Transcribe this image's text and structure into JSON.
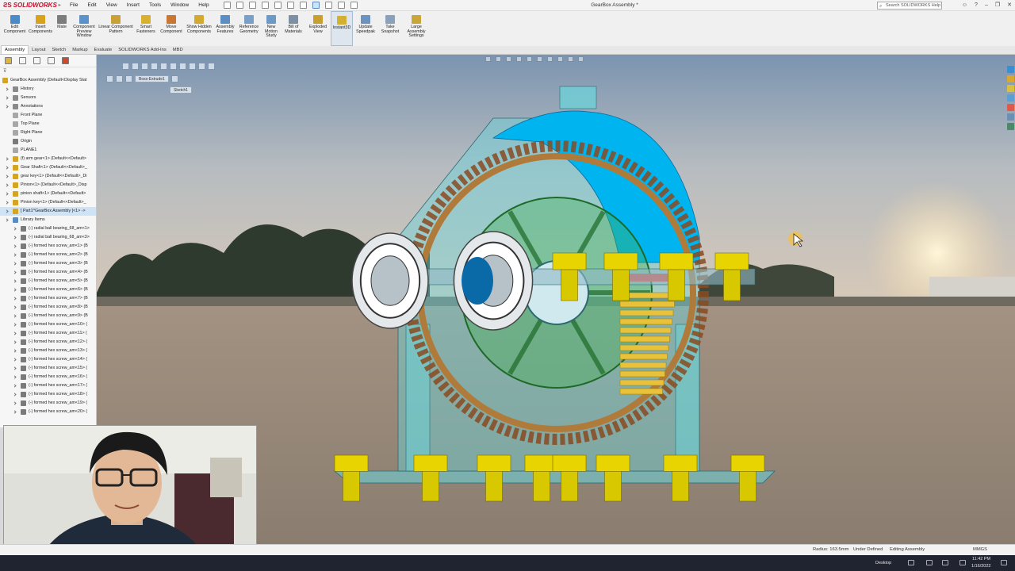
{
  "app": {
    "logo": "SOLIDWORKS",
    "window_title": "GearBox Assembly *",
    "search_placeholder": "Search SOLIDWORKS Help"
  },
  "menu": [
    "File",
    "Edit",
    "View",
    "Insert",
    "Tools",
    "Window",
    "Help"
  ],
  "commands": [
    {
      "label": "Edit Component",
      "icon": "edit-component-icon",
      "color": "#4a8ac8"
    },
    {
      "label": "Insert Components",
      "icon": "insert-components-icon",
      "color": "#d9a21b"
    },
    {
      "label": "Mate",
      "icon": "mate-icon",
      "color": "#7c7c7c"
    },
    {
      "label": "Component Preview Window",
      "icon": "component-preview-icon",
      "color": "#5a92c9"
    },
    {
      "label": "Linear Component Pattern",
      "icon": "linear-pattern-icon",
      "color": "#c9a137"
    },
    {
      "label": "Smart Fasteners",
      "icon": "smart-fasteners-icon",
      "color": "#d8b12e"
    },
    {
      "label": "Move Component",
      "icon": "move-component-icon",
      "color": "#c87832"
    },
    {
      "label": "Show Hidden Components",
      "icon": "show-hidden-icon",
      "color": "#d4a930"
    },
    {
      "label": "Assembly Features",
      "icon": "assembly-features-icon",
      "color": "#5b8fc4"
    },
    {
      "label": "Reference Geometry",
      "icon": "reference-geometry-icon",
      "color": "#7ba0c8"
    },
    {
      "label": "New Motion Study",
      "icon": "motion-study-icon",
      "color": "#6c9ac6"
    },
    {
      "label": "Bill of Materials",
      "icon": "bom-icon",
      "color": "#7d8fa3"
    },
    {
      "label": "Exploded View",
      "icon": "exploded-view-icon",
      "color": "#c9a030"
    },
    {
      "label": "Instant3D",
      "icon": "instant3d-icon",
      "color": "#d1b032"
    },
    {
      "label": "Update Speedpak",
      "icon": "speedpak-icon",
      "color": "#6b93c0"
    },
    {
      "label": "Take Snapshot",
      "icon": "snapshot-icon",
      "color": "#8aa1bb"
    },
    {
      "label": "Large Assembly Settings",
      "icon": "large-assembly-icon",
      "color": "#c9a53a"
    }
  ],
  "tabs": [
    "Assembly",
    "Layout",
    "Sketch",
    "Markup",
    "Evaluate",
    "SOLIDWORKS Add-Ins",
    "MBD"
  ],
  "tree": {
    "root": "GearBox Assembly  (Default<Display Stat",
    "items": [
      {
        "label": "History",
        "icon": "history-icon",
        "color": "#8a8a8a"
      },
      {
        "label": "Sensors",
        "icon": "sensors-icon",
        "color": "#8a8a8a"
      },
      {
        "label": "Annotations",
        "icon": "annotations-icon",
        "color": "#8a8a8a"
      },
      {
        "label": "Front Plane",
        "icon": "plane-icon",
        "color": "#a7a7a7"
      },
      {
        "label": "Top Plane",
        "icon": "plane-icon",
        "color": "#a7a7a7"
      },
      {
        "label": "Right Plane",
        "icon": "plane-icon",
        "color": "#a7a7a7"
      },
      {
        "label": "Origin",
        "icon": "origin-icon",
        "color": "#7a7a7a"
      },
      {
        "label": "PLANE1",
        "icon": "plane-icon",
        "color": "#a7a7a7"
      },
      {
        "label": "(f) arm gear<1> (Default<<Default>",
        "icon": "part-icon",
        "color": "#d6a520"
      },
      {
        "label": "Gear Shaft<1> (Default<<Default>_",
        "icon": "part-icon",
        "color": "#d6a520"
      },
      {
        "label": "gear key<1> (Default<<Default>_Di",
        "icon": "part-icon",
        "color": "#d6a520"
      },
      {
        "label": "Pinion<1> (Default<<Default>_Disp",
        "icon": "part-icon",
        "color": "#d6a520"
      },
      {
        "label": "pinion shaft<1> (Default<<Default>",
        "icon": "part-icon",
        "color": "#d6a520"
      },
      {
        "label": "Pinion key<1> (Default<<Default>_",
        "icon": "part-icon",
        "color": "#d6a520"
      },
      {
        "label": "[ Part1^GearBox Assembly ]<1> -> ",
        "icon": "part-icon",
        "color": "#d6a520"
      },
      {
        "label": "Library Items",
        "icon": "folder-icon",
        "color": "#5a8bc0"
      },
      {
        "label": "(-) radial ball bearing_68_am<1>",
        "icon": "toolbox-icon",
        "color": "#7a7a7a"
      },
      {
        "label": "(-) radial ball bearing_68_am<3>",
        "icon": "toolbox-icon",
        "color": "#7a7a7a"
      },
      {
        "label": "(-) formed hex screw_am<1> (B",
        "icon": "toolbox-icon",
        "color": "#7a7a7a"
      },
      {
        "label": "(-) formed hex screw_am<2> (B",
        "icon": "toolbox-icon",
        "color": "#7a7a7a"
      },
      {
        "label": "(-) formed hex screw_am<3> (B",
        "icon": "toolbox-icon",
        "color": "#7a7a7a"
      },
      {
        "label": "(-) formed hex screw_am<4> (B",
        "icon": "toolbox-icon",
        "color": "#7a7a7a"
      },
      {
        "label": "(-) formed hex screw_am<5> (B",
        "icon": "toolbox-icon",
        "color": "#7a7a7a"
      },
      {
        "label": "(-) formed hex screw_am<6> (B",
        "icon": "toolbox-icon",
        "color": "#7a7a7a"
      },
      {
        "label": "(-) formed hex screw_am<7> (B",
        "icon": "toolbox-icon",
        "color": "#7a7a7a"
      },
      {
        "label": "(-) formed hex screw_am<8> (B",
        "icon": "toolbox-icon",
        "color": "#7a7a7a"
      },
      {
        "label": "(-) formed hex screw_am<9> (B",
        "icon": "toolbox-icon",
        "color": "#7a7a7a"
      },
      {
        "label": "(-) formed hex screw_am<10> (",
        "icon": "toolbox-icon",
        "color": "#7a7a7a"
      },
      {
        "label": "(-) formed hex screw_am<11> (",
        "icon": "toolbox-icon",
        "color": "#7a7a7a"
      },
      {
        "label": "(-) formed hex screw_am<12> (",
        "icon": "toolbox-icon",
        "color": "#7a7a7a"
      },
      {
        "label": "(-) formed hex screw_am<13> (",
        "icon": "toolbox-icon",
        "color": "#7a7a7a"
      },
      {
        "label": "(-) formed hex screw_am<14> (",
        "icon": "toolbox-icon",
        "color": "#7a7a7a"
      },
      {
        "label": "(-) formed hex screw_am<15> (",
        "icon": "toolbox-icon",
        "color": "#7a7a7a"
      },
      {
        "label": "(-) formed hex screw_am<16> (",
        "icon": "toolbox-icon",
        "color": "#7a7a7a"
      },
      {
        "label": "(-) formed hex screw_am<17> (",
        "icon": "toolbox-icon",
        "color": "#7a7a7a"
      },
      {
        "label": "(-) formed hex screw_am<18> (",
        "icon": "toolbox-icon",
        "color": "#7a7a7a"
      },
      {
        "label": "(-) formed hex screw_am<19> (",
        "icon": "toolbox-icon",
        "color": "#7a7a7a"
      },
      {
        "label": "(-) formed hex screw_am<20> (",
        "icon": "toolbox-icon",
        "color": "#7a7a7a"
      }
    ]
  },
  "viewport": {
    "breadcrumb": [
      "Boss-Extrude1"
    ],
    "breadcrumb_sub": "Sketch1",
    "colors": {
      "sky_top": "#7b94b0",
      "sky_horizon": "#d8c9b8",
      "ground": "#8a7d6f",
      "housing": "#6ad5dc",
      "cover": "#00b4f0",
      "gear_bronze": "#8a4a20",
      "gear_green": "#3fae4b",
      "bolt": "#e7d400"
    }
  },
  "status": {
    "radius": "Radius: 163.5mm",
    "definition": "Under Defined",
    "mode": "Editing Assembly",
    "units": "MMGS"
  },
  "taskbar": {
    "desktop": "Desktop",
    "time": "11:42 PM",
    "date": "1/16/2022"
  }
}
